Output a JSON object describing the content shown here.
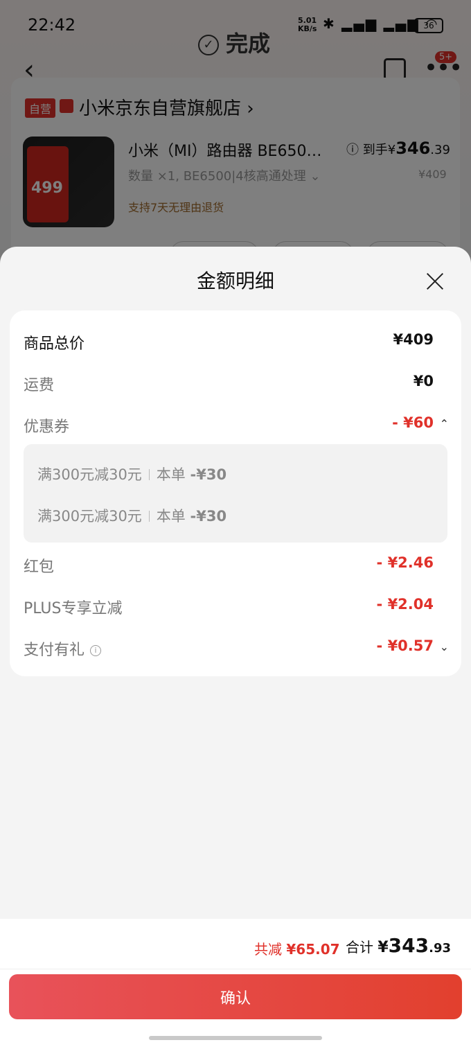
{
  "status_bar": {
    "time": "22:42",
    "net_speed": "5.01",
    "net_unit": "KB/s",
    "battery": "36"
  },
  "header": {
    "title": "完成",
    "more_badge": "5+"
  },
  "store": {
    "self_tag": "自营",
    "name": "小米京东自营旗舰店 ›",
    "product": {
      "title": "小米（MI）路由器 BE650…",
      "spec": "数量 ×1, BE6500|4核高通处理 ⌄",
      "return_policy": "支持7天无理由退货",
      "net_label": "ⓘ 到手¥",
      "net_int": "346",
      "net_dec": ".39",
      "orig_price": "¥409",
      "img_price": "499"
    }
  },
  "sheet": {
    "title": "金额明细",
    "rows": {
      "total_goods": {
        "label": "商品总价",
        "value": "¥409"
      },
      "shipping": {
        "label": "运费",
        "value": "¥0"
      },
      "coupon": {
        "label": "优惠券",
        "value": "- ¥60"
      },
      "red_packet": {
        "label": "红包",
        "value": "- ¥2.46"
      },
      "plus": {
        "label": "PLUS专享立减",
        "value": "- ¥2.04"
      },
      "pay_gift": {
        "label": "支付有礼",
        "value": "- ¥0.57"
      }
    },
    "coupon_items": [
      {
        "rule": "满300元减30元",
        "scope": "本单",
        "amount": "-¥30"
      },
      {
        "rule": "满300元减30元",
        "scope": "本单",
        "amount": "-¥30"
      }
    ]
  },
  "bottom": {
    "saved_label": "共减",
    "saved_value": "¥65.07",
    "total_label": "合计",
    "total_yen": "¥",
    "total_int": "343",
    "total_dec": ".93",
    "confirm": "确认"
  },
  "colors": {
    "accent": "#e0312a",
    "confirm_start": "#e8525a",
    "confirm_end": "#e2402e"
  }
}
